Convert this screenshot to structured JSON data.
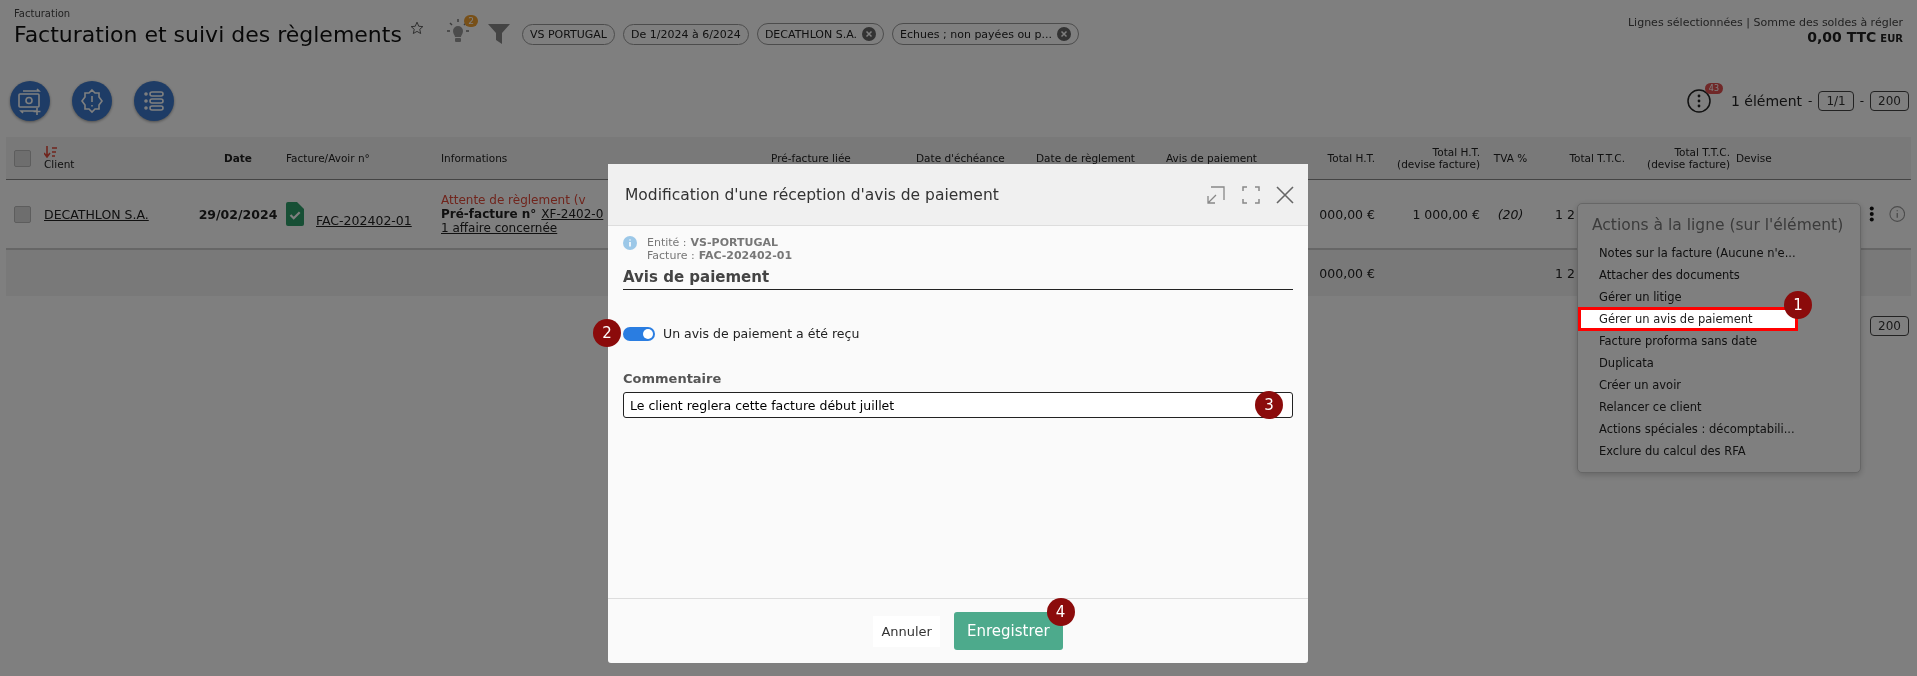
{
  "header": {
    "breadcrumb": "Facturation",
    "title": "Facturation et suivi des règlements",
    "favorite": false,
    "tips_badge": "2"
  },
  "filters": [
    {
      "label": "VS PORTUGAL",
      "removable": false
    },
    {
      "label": "De 1/2024 à 6/2024",
      "removable": false
    },
    {
      "label": "DECATHLON S.A.",
      "removable": true
    },
    {
      "label": "Echues ; non payées ou p...",
      "removable": true
    }
  ],
  "selection_summary": {
    "label": "Lignes sélectionnées | Somme des soldes à régler",
    "amount": "0,00 TTC",
    "currency": "EUR"
  },
  "actions": [
    {
      "kind": "new-invoice"
    },
    {
      "kind": "alert"
    },
    {
      "kind": "list"
    }
  ],
  "pagination": {
    "menu_badge": "43",
    "count": "1 élément",
    "separator_1": "-",
    "page": "1/1",
    "separator_2": "-",
    "page_size": "200"
  },
  "table": {
    "select_all": false,
    "columns": [
      {
        "label": "Client",
        "sorted": true
      },
      {
        "label": "Date",
        "sorted": false
      },
      {
        "label": "Facture/Avoir n°",
        "sorted": false
      },
      {
        "label": "Informations",
        "sorted": false
      },
      {
        "label": "Pré-facture liée",
        "sorted": false
      },
      {
        "label": "Date d'échéance",
        "sorted": false
      },
      {
        "label": "Date de règlement",
        "sorted": false
      },
      {
        "label": "Avis de paiement",
        "sorted": false
      },
      {
        "label": "Total H.T.",
        "sorted": false
      },
      {
        "label": "Total H.T.",
        "sublabel": "(devise facture)",
        "sorted": false
      },
      {
        "label": "TVA %",
        "sorted": false
      },
      {
        "label": "Total T.T.C.",
        "sorted": false
      },
      {
        "label": "Total T.T.C.",
        "sublabel": "(devise facture)",
        "sorted": false
      },
      {
        "label": "Devise",
        "sorted": false
      }
    ],
    "rows": [
      {
        "selected": false,
        "client": "DECATHLON S.A.",
        "date": "29/02/2024",
        "invoice": "FAC-202402-01",
        "status": "Attente de règlement (v",
        "pre_invoice_label": "Pré-facture n°",
        "pre_invoice": "XF-2402-0",
        "affairs": "1 affaire concernée",
        "total_ht": "000,00 €",
        "total_ht_currency": "1 000,00 €",
        "vat": "(20)",
        "total_ttc": "1 2"
      }
    ],
    "total_row": {
      "total_ht": "000,00 €",
      "total_ttc": "1 2"
    }
  },
  "bottom_pagination": {
    "page_size": "200"
  },
  "row_menu": {
    "title": "Actions à la ligne (sur l'élément)",
    "items": [
      {
        "label": "Notes sur la facture (Aucune n'e...",
        "highlighted": false
      },
      {
        "label": "Attacher des documents",
        "highlighted": false
      },
      {
        "label": "Gérer un litige",
        "highlighted": false
      },
      {
        "label": "Gérer un avis de paiement",
        "highlighted": true,
        "marker": "1"
      },
      {
        "label": "Facture proforma sans date",
        "highlighted": false
      },
      {
        "label": "Duplicata",
        "highlighted": false
      },
      {
        "label": "Créer un avoir",
        "highlighted": false
      },
      {
        "label": "Relancer ce client",
        "highlighted": false
      },
      {
        "label": "Actions spéciales : décomptabili...",
        "highlighted": false
      },
      {
        "label": "Exclure du calcul des RFA",
        "highlighted": false
      }
    ]
  },
  "modal": {
    "title": "Modification d'une réception d'avis de paiement",
    "info": [
      {
        "label": "Entité :",
        "value": "VS-PORTUGAL"
      },
      {
        "label": "Facture :",
        "value": "FAC-202402-01"
      }
    ],
    "section": "Avis de paiement",
    "toggle": {
      "label": "Un avis de paiement a été reçu",
      "on": true,
      "marker": "2"
    },
    "comment": {
      "label": "Commentaire",
      "value": "Le client reglera cette facture début juillet",
      "marker": "3"
    },
    "buttons": [
      {
        "label": "Annuler",
        "kind": "secondary"
      },
      {
        "label": "Enregistrer",
        "kind": "primary",
        "marker": "4"
      }
    ]
  }
}
